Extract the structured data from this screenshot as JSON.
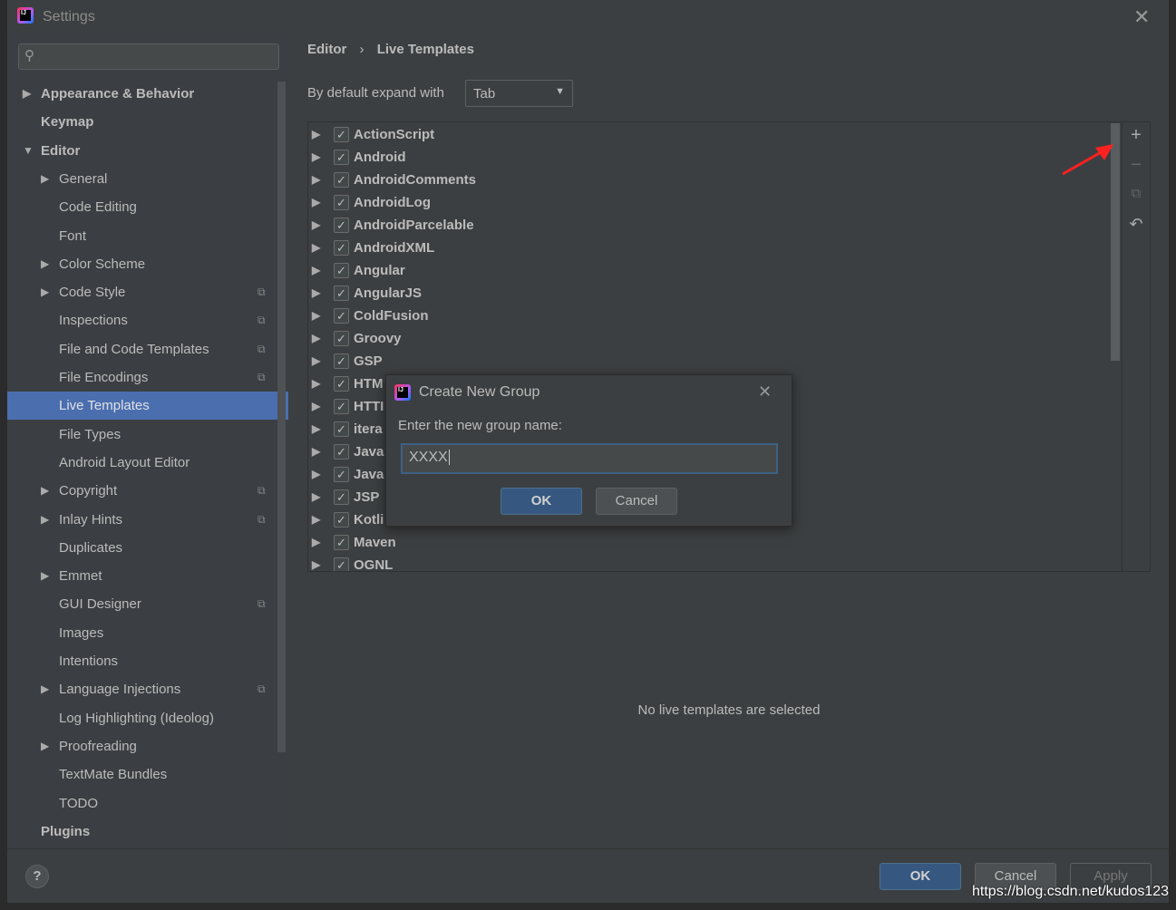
{
  "window": {
    "title": "Settings",
    "close_icon": "close-icon"
  },
  "sidebar": {
    "search_placeholder": "",
    "items": [
      {
        "label": "Appearance & Behavior",
        "level": 0,
        "arrow": "right",
        "bold": true
      },
      {
        "label": "Keymap",
        "level": 0,
        "bold": true
      },
      {
        "label": "Editor",
        "level": 0,
        "arrow": "down",
        "bold": true
      },
      {
        "label": "General",
        "level": 1,
        "arrow": "right"
      },
      {
        "label": "Code Editing",
        "level": 1
      },
      {
        "label": "Font",
        "level": 1
      },
      {
        "label": "Color Scheme",
        "level": 1,
        "arrow": "right"
      },
      {
        "label": "Code Style",
        "level": 1,
        "arrow": "right",
        "scope": true
      },
      {
        "label": "Inspections",
        "level": 1,
        "scope": true
      },
      {
        "label": "File and Code Templates",
        "level": 1,
        "scope": true
      },
      {
        "label": "File Encodings",
        "level": 1,
        "scope": true
      },
      {
        "label": "Live Templates",
        "level": 1,
        "selected": true
      },
      {
        "label": "File Types",
        "level": 1
      },
      {
        "label": "Android Layout Editor",
        "level": 1
      },
      {
        "label": "Copyright",
        "level": 1,
        "arrow": "right",
        "scope": true
      },
      {
        "label": "Inlay Hints",
        "level": 1,
        "arrow": "right",
        "scope": true
      },
      {
        "label": "Duplicates",
        "level": 1
      },
      {
        "label": "Emmet",
        "level": 1,
        "arrow": "right"
      },
      {
        "label": "GUI Designer",
        "level": 1,
        "scope": true
      },
      {
        "label": "Images",
        "level": 1
      },
      {
        "label": "Intentions",
        "level": 1
      },
      {
        "label": "Language Injections",
        "level": 1,
        "arrow": "right",
        "scope": true
      },
      {
        "label": "Log Highlighting (Ideolog)",
        "level": 1
      },
      {
        "label": "Proofreading",
        "level": 1,
        "arrow": "right"
      },
      {
        "label": "TextMate Bundles",
        "level": 1
      },
      {
        "label": "TODO",
        "level": 1
      },
      {
        "label": "Plugins",
        "level": 0,
        "bold": true
      }
    ]
  },
  "breadcrumb": {
    "parent": "Editor",
    "separator": "›",
    "current": "Live Templates"
  },
  "expand": {
    "label": "By default expand with",
    "value": "Tab"
  },
  "templates": [
    {
      "name": "ActionScript",
      "checked": true
    },
    {
      "name": "Android",
      "checked": true
    },
    {
      "name": "AndroidComments",
      "checked": true
    },
    {
      "name": "AndroidLog",
      "checked": true
    },
    {
      "name": "AndroidParcelable",
      "checked": true
    },
    {
      "name": "AndroidXML",
      "checked": true
    },
    {
      "name": "Angular",
      "checked": true
    },
    {
      "name": "AngularJS",
      "checked": true
    },
    {
      "name": "ColdFusion",
      "checked": true
    },
    {
      "name": "Groovy",
      "checked": true
    },
    {
      "name": "GSP",
      "checked": true
    },
    {
      "name": "HTM",
      "checked": true
    },
    {
      "name": "HTTI",
      "checked": true
    },
    {
      "name": "itera",
      "checked": true
    },
    {
      "name": "Java",
      "checked": true
    },
    {
      "name": "Java",
      "checked": true
    },
    {
      "name": "JSP",
      "checked": true
    },
    {
      "name": "Kotli",
      "checked": true
    },
    {
      "name": "Maven",
      "checked": true
    },
    {
      "name": "OGNL",
      "checked": true
    }
  ],
  "toolbar": {
    "add": "+",
    "remove": "−",
    "copy_icon": "copy-icon",
    "restore_icon": "undo-icon"
  },
  "no_selection": "No live templates are selected",
  "footer": {
    "help": "?",
    "ok": "OK",
    "cancel": "Cancel",
    "apply": "Apply"
  },
  "dialog": {
    "title": "Create New Group",
    "prompt": "Enter the new group name:",
    "value": "XXXX",
    "ok": "OK",
    "cancel": "Cancel"
  },
  "watermark": "https://blog.csdn.net/kudos123",
  "colors": {
    "selection": "#4b6eaf",
    "primary_button": "#365880",
    "annotation_arrow": "#ff2020"
  }
}
